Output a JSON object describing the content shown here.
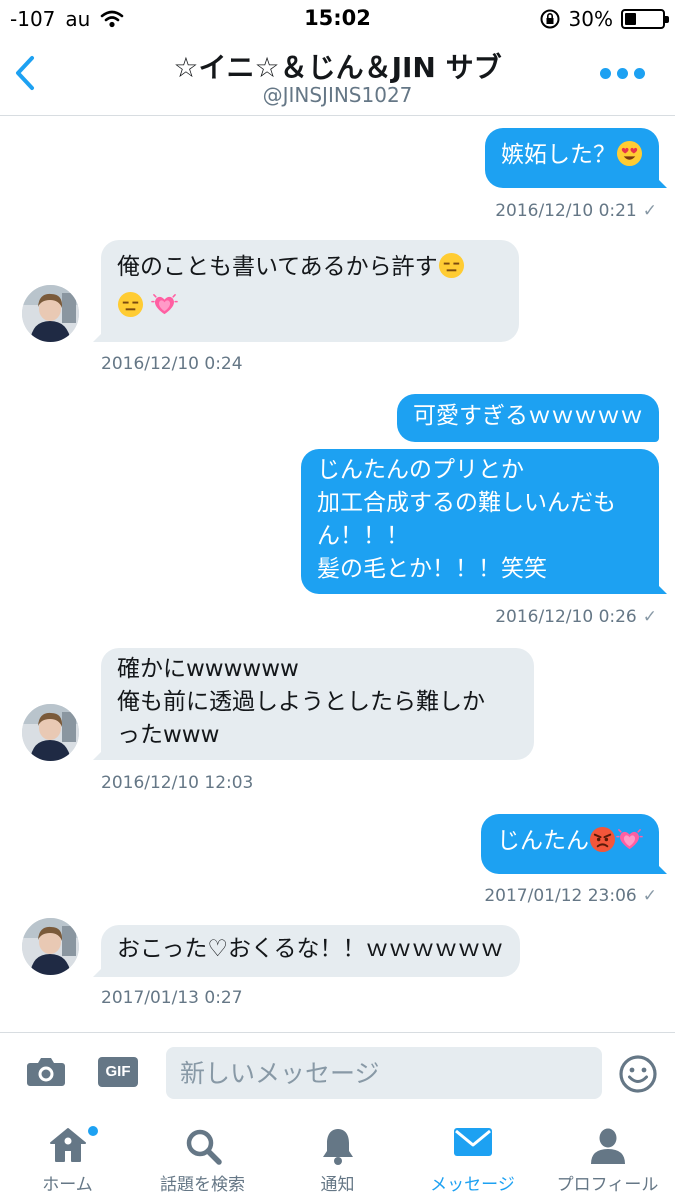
{
  "status_bar": {
    "signal": "-107",
    "carrier": "au",
    "time": "15:02",
    "battery": "30%",
    "battery_level": 0.3
  },
  "header": {
    "title": "☆イニ☆＆じん＆JIN サブ",
    "handle": "@JINSJINS1027"
  },
  "messages": [
    {
      "lines": [
        "嫉妬した？"
      ],
      "emoji": [
        "heart-eyes"
      ],
      "timestamp": "2016/12/10 0:21"
    },
    {
      "lines": [
        "俺のことも書いてあるから許す"
      ],
      "emoji": [
        "expressionless",
        "expressionless",
        "heart-growing"
      ],
      "timestamp": "2016/12/10 0:24"
    },
    {
      "lines": [
        "可愛すぎるｗｗｗｗｗ"
      ]
    },
    {
      "lines": [
        "じんたんのプリとか",
        "加工合成するの難しいんだも",
        "ん！！！",
        "髪の毛とか！！！笑笑"
      ],
      "timestamp": "2016/12/10 0:26"
    },
    {
      "lines": [
        "確かにwwwwww",
        "俺も前に透過しようとしたら難しか",
        "ったwww"
      ],
      "timestamp": "2016/12/10 12:03"
    },
    {
      "lines": [
        "じんたん"
      ],
      "emoji": [
        "pouting-face",
        "heart-growing"
      ],
      "timestamp": "2017/01/12 23:06"
    },
    {
      "lines": [
        "おこった♡おくるな！！ｗｗｗｗｗｗ"
      ],
      "timestamp": "2017/01/13 0:27"
    }
  ],
  "composer": {
    "placeholder": "新しいメッセージ",
    "gif_label": "GIF"
  },
  "tabs": [
    {
      "label": "ホーム",
      "icon": "home-icon"
    },
    {
      "label": "話題を検索",
      "icon": "search-icon"
    },
    {
      "label": "通知",
      "icon": "bell-icon"
    },
    {
      "label": "メッセージ",
      "icon": "envelope-icon",
      "active": true
    },
    {
      "label": "プロフィール",
      "icon": "person-icon"
    }
  ],
  "colors": {
    "accent": "#1da1f2",
    "incoming_bubble": "#e6ecf0",
    "muted_text": "#657786"
  }
}
